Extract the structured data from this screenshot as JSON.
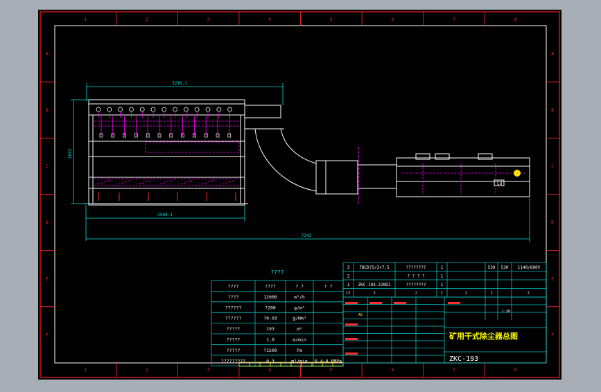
{
  "colors": {
    "background": "#a7aeb6",
    "paper": "#000000",
    "frame_outer": "#ff2020",
    "frame_inner": "#ffffff",
    "ticks": "#ff3030",
    "dimension": "#00e0e0",
    "hidden": "#ff00ff",
    "table_lines": "#00c8c8",
    "table_text": "#ffffff",
    "title_yellow": "#ffff00",
    "marker": "#ffdd00"
  },
  "border": {
    "columns": [
      "1",
      "2",
      "3",
      "4",
      "5",
      "6",
      "7",
      "8"
    ],
    "rows": [
      "A",
      "B",
      "C",
      "D",
      "E",
      "F"
    ]
  },
  "dimensions": {
    "top_width": "3210.1",
    "height": "1693",
    "body_length": "2580.1",
    "total_length": "7242"
  },
  "callouts": {
    "motor_label": "Ld"
  },
  "spec_table": {
    "title": "????",
    "headers": [
      "????",
      "????",
      "? ?",
      "? ?"
    ],
    "rows": [
      {
        "name": "????",
        "value": "12000",
        "unit": "m³/h",
        "note": ""
      },
      {
        "name": "??????",
        "value": "?200",
        "unit": "g/m³",
        "note": ""
      },
      {
        "name": "??????",
        "value": "?0.03",
        "unit": "g/Nm³",
        "note": ""
      },
      {
        "name": "?????",
        "value": "193",
        "unit": "m²",
        "note": ""
      },
      {
        "name": "?????",
        "value": "1.0",
        "unit": "m/min",
        "note": ""
      },
      {
        "name": "?????",
        "value": "?1500",
        "unit": "Pa",
        "note": ""
      },
      {
        "name": "?????????",
        "value": "0.3",
        "unit": "m³/min",
        "note": "0.4~0.6MPa"
      }
    ]
  },
  "parts_list": {
    "rows": [
      {
        "no": "3",
        "code": "FBCD?5/2×7.5",
        "name": "????????",
        "qty": "1",
        "c1": "",
        "c2": "530",
        "c3": "530",
        "note": "1140/660V"
      },
      {
        "no": "2",
        "code": "",
        "name": "? ? ? ?",
        "qty": "1",
        "c1": "",
        "c2": "",
        "c3": "",
        "note": ""
      },
      {
        "no": "1",
        "code": "ZKC-193-220D1",
        "name": "????????",
        "qty": "1",
        "c1": "",
        "c2": "",
        "c3": "",
        "note": ""
      }
    ],
    "header": {
      "no": "??",
      "code": "?",
      "name": "?",
      "qty": "?",
      "c1": "?",
      "c2": "?",
      "note": "?"
    }
  },
  "title_block": {
    "drawing_title": "矿用干式除尘器总图",
    "drawing_number": "ZKC-193",
    "scale": "1:30",
    "mark": "AS"
  }
}
